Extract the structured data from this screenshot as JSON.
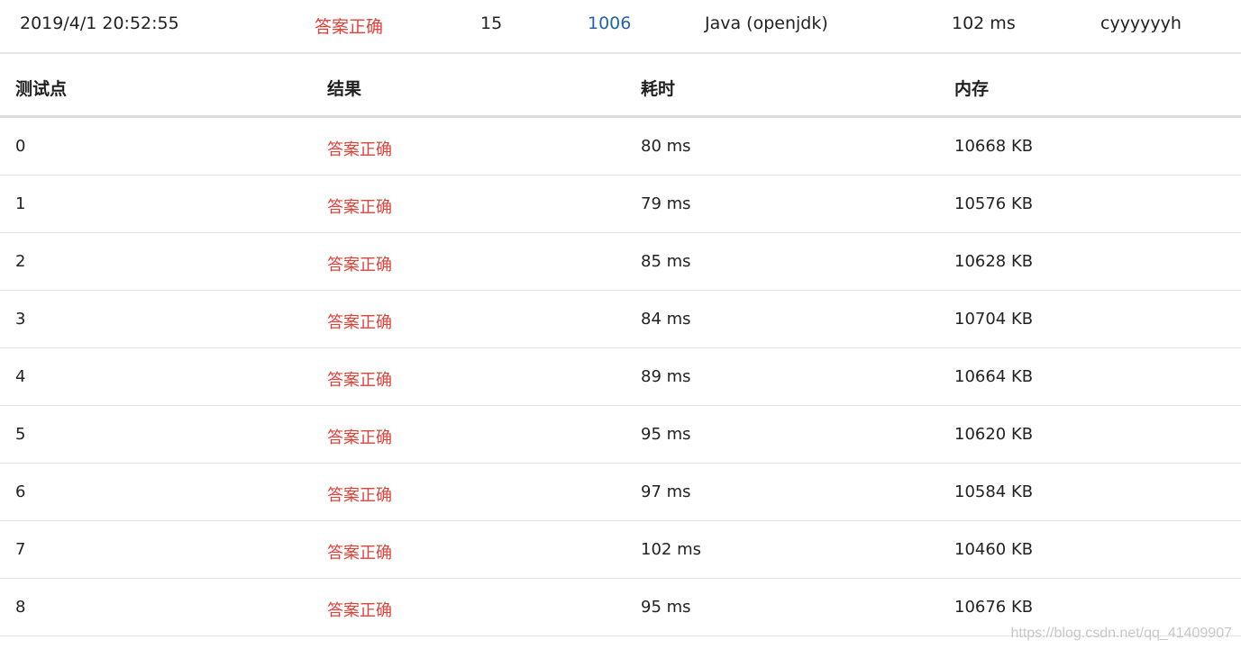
{
  "submission": {
    "time": "2019/4/1 20:52:55",
    "status": "答案正确",
    "score": "15",
    "problem": "1006",
    "language": "Java (openjdk)",
    "runtime": "102 ms",
    "user": "cyyyyyyh"
  },
  "table": {
    "headers": [
      "测试点",
      "结果",
      "耗时",
      "内存"
    ],
    "rows": [
      [
        "0",
        "答案正确",
        "80 ms",
        "10668 KB"
      ],
      [
        "1",
        "答案正确",
        "79 ms",
        "10576 KB"
      ],
      [
        "2",
        "答案正确",
        "85 ms",
        "10628 KB"
      ],
      [
        "3",
        "答案正确",
        "84 ms",
        "10704 KB"
      ],
      [
        "4",
        "答案正确",
        "89 ms",
        "10664 KB"
      ],
      [
        "5",
        "答案正确",
        "95 ms",
        "10620 KB"
      ],
      [
        "6",
        "答案正确",
        "97 ms",
        "10584 KB"
      ],
      [
        "7",
        "答案正确",
        "102 ms",
        "10460 KB"
      ],
      [
        "8",
        "答案正确",
        "95 ms",
        "10676 KB"
      ]
    ]
  },
  "watermark": "https://blog.csdn.net/qq_41409907",
  "colors": {
    "accepted": "#e1403a",
    "link": "#2563a8"
  }
}
